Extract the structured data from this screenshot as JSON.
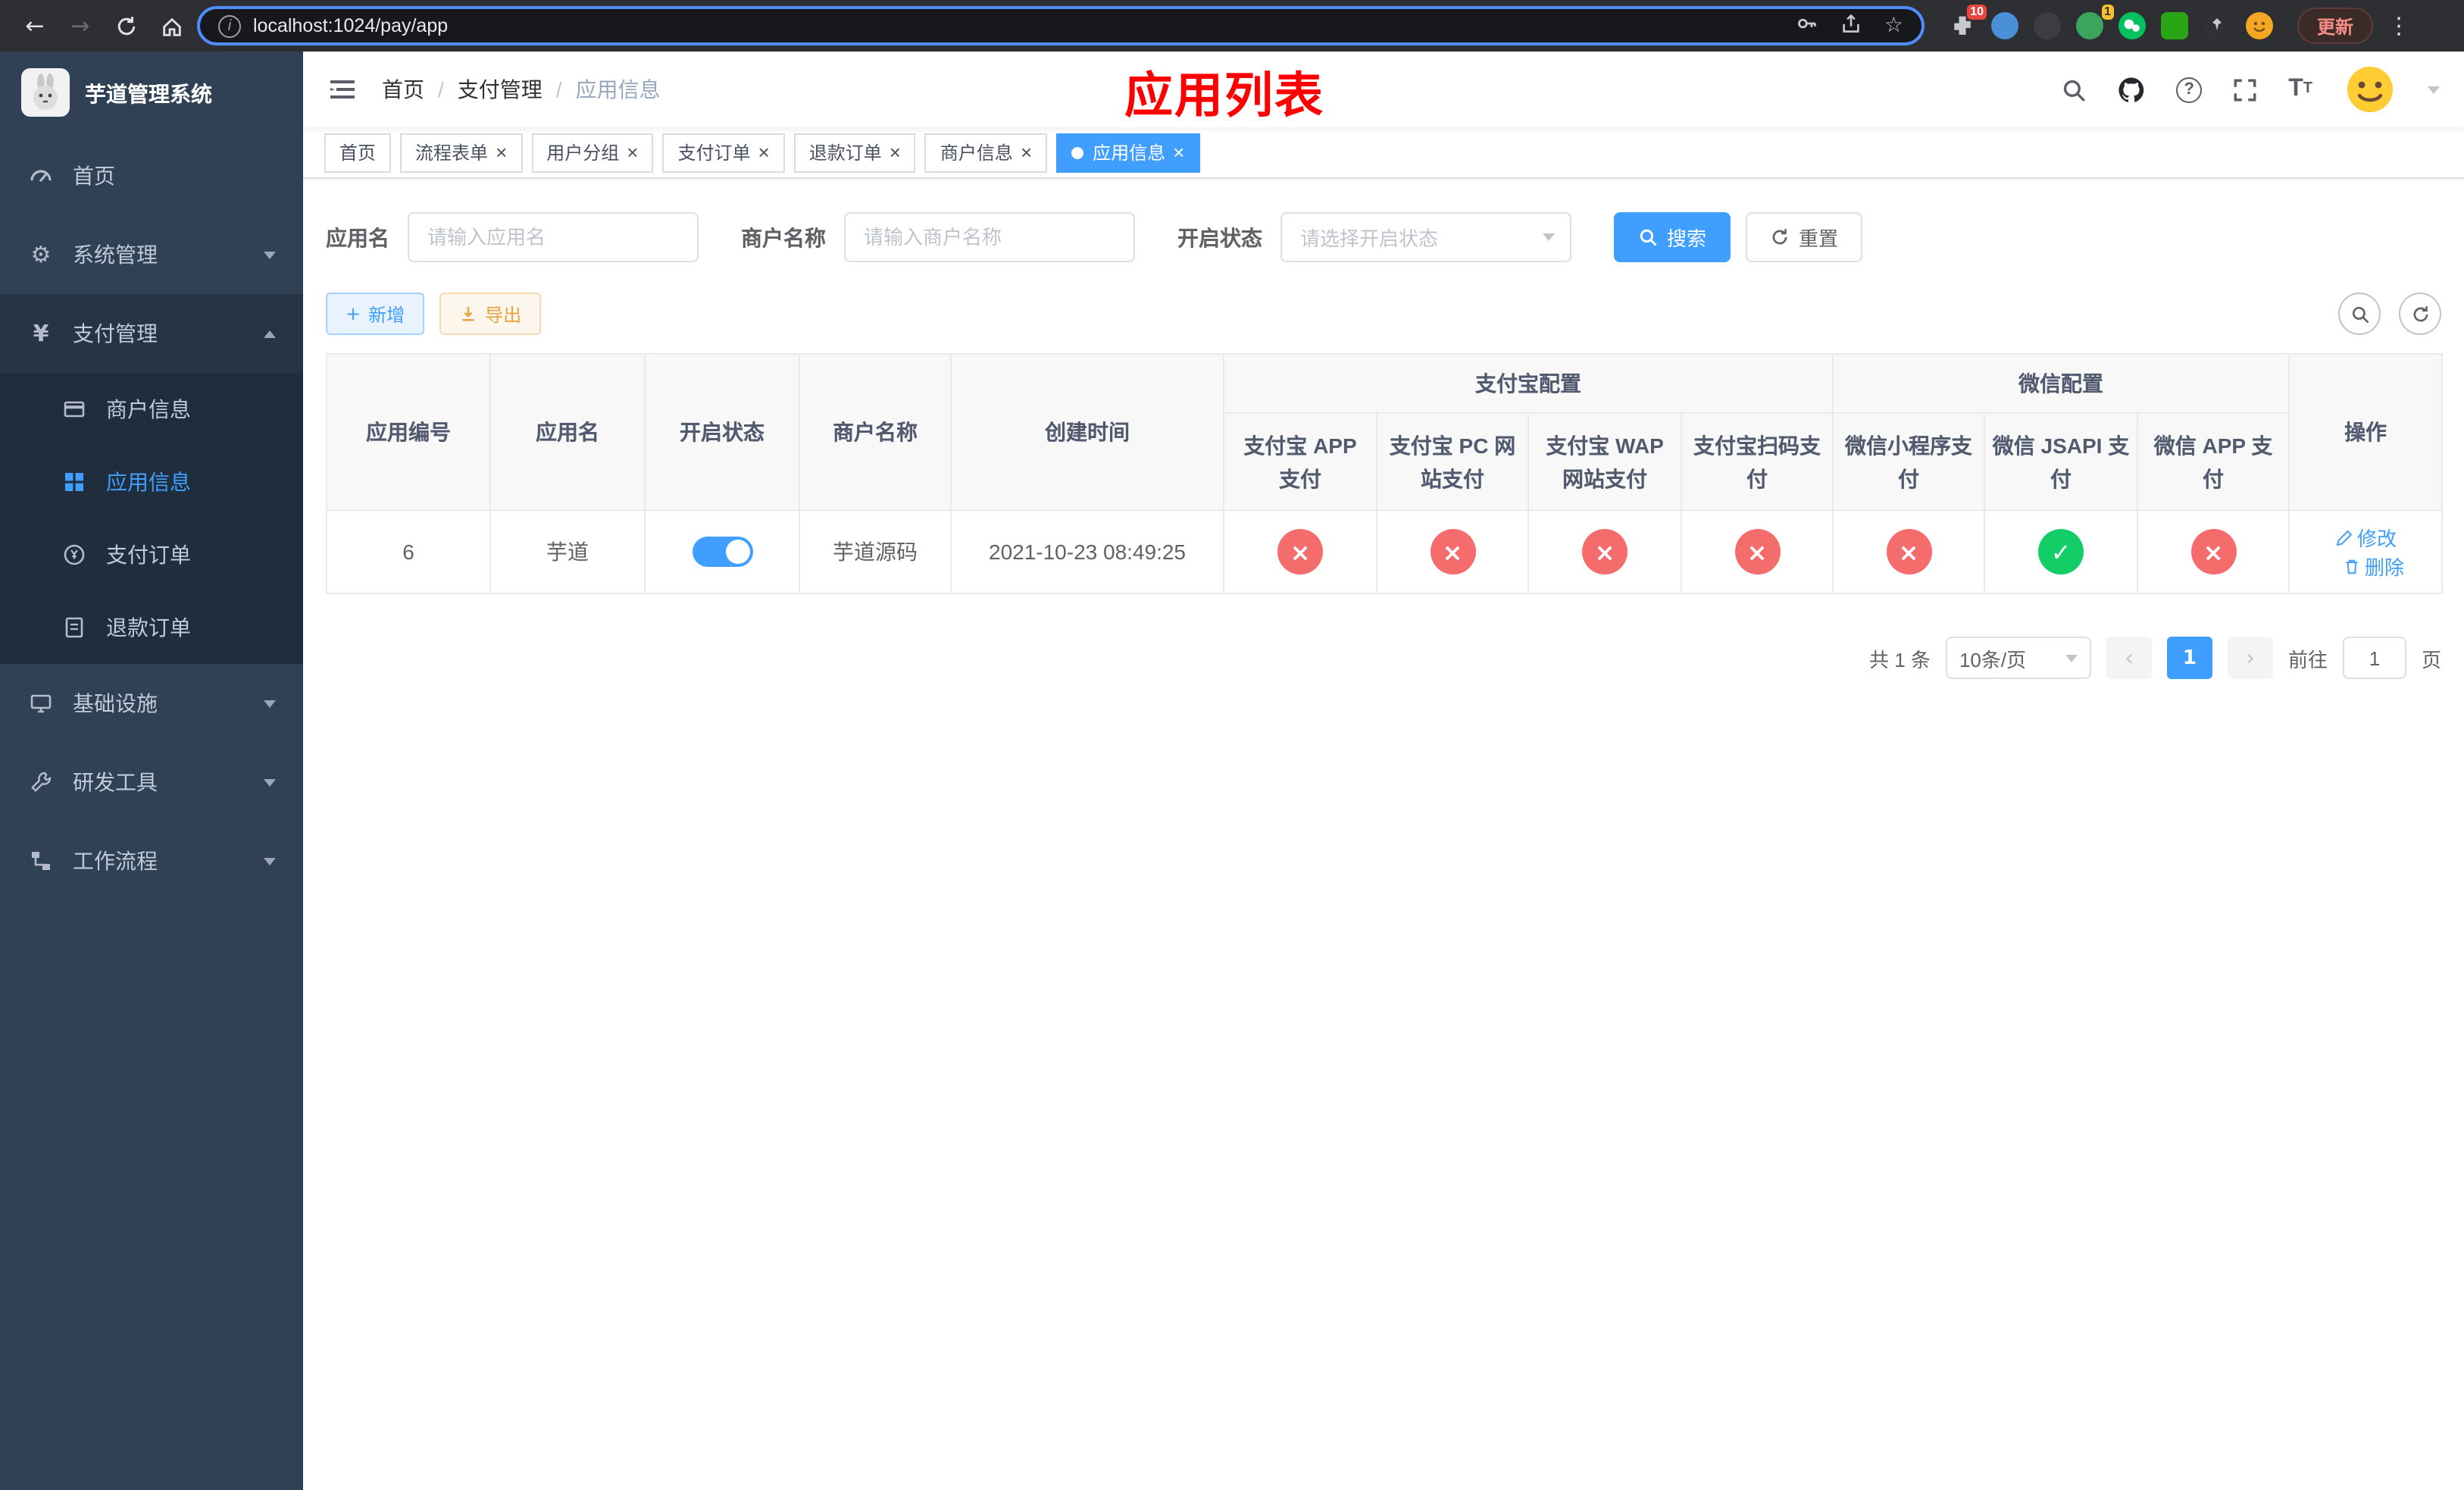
{
  "browser": {
    "url": "localhost:1024/pay/app",
    "update_label": "更新",
    "extensions_badge": "10",
    "extension_badge_alt": "1"
  },
  "icons": {
    "back": "←",
    "forward": "→",
    "home": "⌂",
    "star": "☆",
    "dots": "⋮",
    "info": "i",
    "close": "×",
    "plus": "+",
    "gear": "⚙",
    "yen": "¥",
    "slash": "/",
    "prev": "‹",
    "next": "›",
    "question": "?"
  },
  "colors": {
    "primary": "#409eff",
    "danger": "#f56c6c",
    "success": "#13ce66",
    "warning": "#e6a23c",
    "title_red": "#ff0000",
    "sidebar_bg": "#304156",
    "submenu_bg": "#1f2d3d"
  },
  "sidebar": {
    "logo_title": "芋道管理系统",
    "menu": [
      {
        "label": "首页"
      },
      {
        "label": "系统管理"
      },
      {
        "label": "支付管理"
      },
      {
        "label": "基础设施"
      },
      {
        "label": "研发工具"
      },
      {
        "label": "工作流程"
      }
    ],
    "payment_submenu": [
      {
        "label": "商户信息"
      },
      {
        "label": "应用信息"
      },
      {
        "label": "支付订单"
      },
      {
        "label": "退款订单"
      }
    ]
  },
  "header": {
    "breadcrumb": [
      "首页",
      "支付管理",
      "应用信息"
    ],
    "title": "应用列表"
  },
  "tabs": [
    {
      "label": "首页"
    },
    {
      "label": "流程表单"
    },
    {
      "label": "用户分组"
    },
    {
      "label": "支付订单"
    },
    {
      "label": "退款订单"
    },
    {
      "label": "商户信息"
    },
    {
      "label": "应用信息"
    }
  ],
  "filters": {
    "app_name_label": "应用名",
    "app_name_placeholder": "请输入应用名",
    "merchant_label": "商户名称",
    "merchant_placeholder": "请输入商户名称",
    "status_label": "开启状态",
    "status_placeholder": "请选择开启状态",
    "search_label": "搜索",
    "reset_label": "重置"
  },
  "toolbar": {
    "add_label": "新增",
    "export_label": "导出"
  },
  "table": {
    "columns": [
      "应用编号",
      "应用名",
      "开启状态",
      "商户名称",
      "创建时间"
    ],
    "groups": [
      {
        "label": "支付宝配置"
      },
      {
        "label": "微信配置"
      }
    ],
    "subcolumns": [
      "支付宝 APP 支付",
      "支付宝 PC 网站支付",
      "支付宝 WAP 网站支付",
      "支付宝扫码支付",
      "微信小程序支付",
      "微信 JSAPI 支付",
      "微信 APP 支付"
    ],
    "actions_column": "操作",
    "rows": [
      {
        "id": "6",
        "name": "芋道",
        "enabled_state": "on",
        "merchant": "芋道源码",
        "created_at": "2021-10-23 08:49:25",
        "statuses": [
          {
            "name": "alipay-app-pay",
            "state": "off",
            "glyph": "×"
          },
          {
            "name": "alipay-pc-pay",
            "state": "off",
            "glyph": "×"
          },
          {
            "name": "alipay-wap-pay",
            "state": "off",
            "glyph": "×"
          },
          {
            "name": "alipay-qr-pay",
            "state": "off",
            "glyph": "×"
          },
          {
            "name": "wechat-mini-pay",
            "state": "off",
            "glyph": "×"
          },
          {
            "name": "wechat-jsapi-pay",
            "state": "on",
            "glyph": "✓"
          },
          {
            "name": "wechat-app-pay",
            "state": "off",
            "glyph": "×"
          }
        ],
        "edit_label": "修改",
        "delete_label": "删除"
      }
    ]
  },
  "pagination": {
    "total_text": "共 1 条",
    "page_size": "10条/页",
    "current_page": "1",
    "goto_prefix": "前往",
    "goto_value": "1",
    "goto_suffix": "页"
  }
}
